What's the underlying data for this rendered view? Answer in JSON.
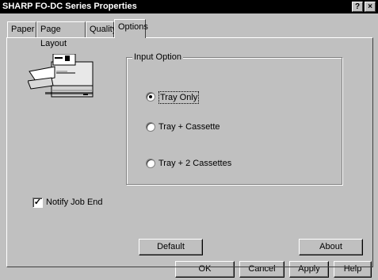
{
  "window": {
    "title": "SHARP FO-DC Series  Properties",
    "help_glyph": "?",
    "close_glyph": "×"
  },
  "tabs": [
    {
      "label": "Paper",
      "active": false
    },
    {
      "label": "Page Layout",
      "active": false
    },
    {
      "label": "Quality",
      "active": false
    },
    {
      "label": "Options",
      "active": true
    }
  ],
  "input_option": {
    "group_label": "Input Option",
    "options": [
      {
        "label": "Tray Only",
        "selected": true
      },
      {
        "label": "Tray + Cassette",
        "selected": false
      },
      {
        "label": "Tray + 2 Cassettes",
        "selected": false
      }
    ]
  },
  "notify": {
    "label": "Notify Job End",
    "checked": true,
    "check_glyph": "✓"
  },
  "panel_buttons": {
    "default_label": "Default",
    "about_label": "About"
  },
  "dialog_buttons": {
    "ok": "OK",
    "cancel": "Cancel",
    "apply": "Apply",
    "help": "Help"
  }
}
